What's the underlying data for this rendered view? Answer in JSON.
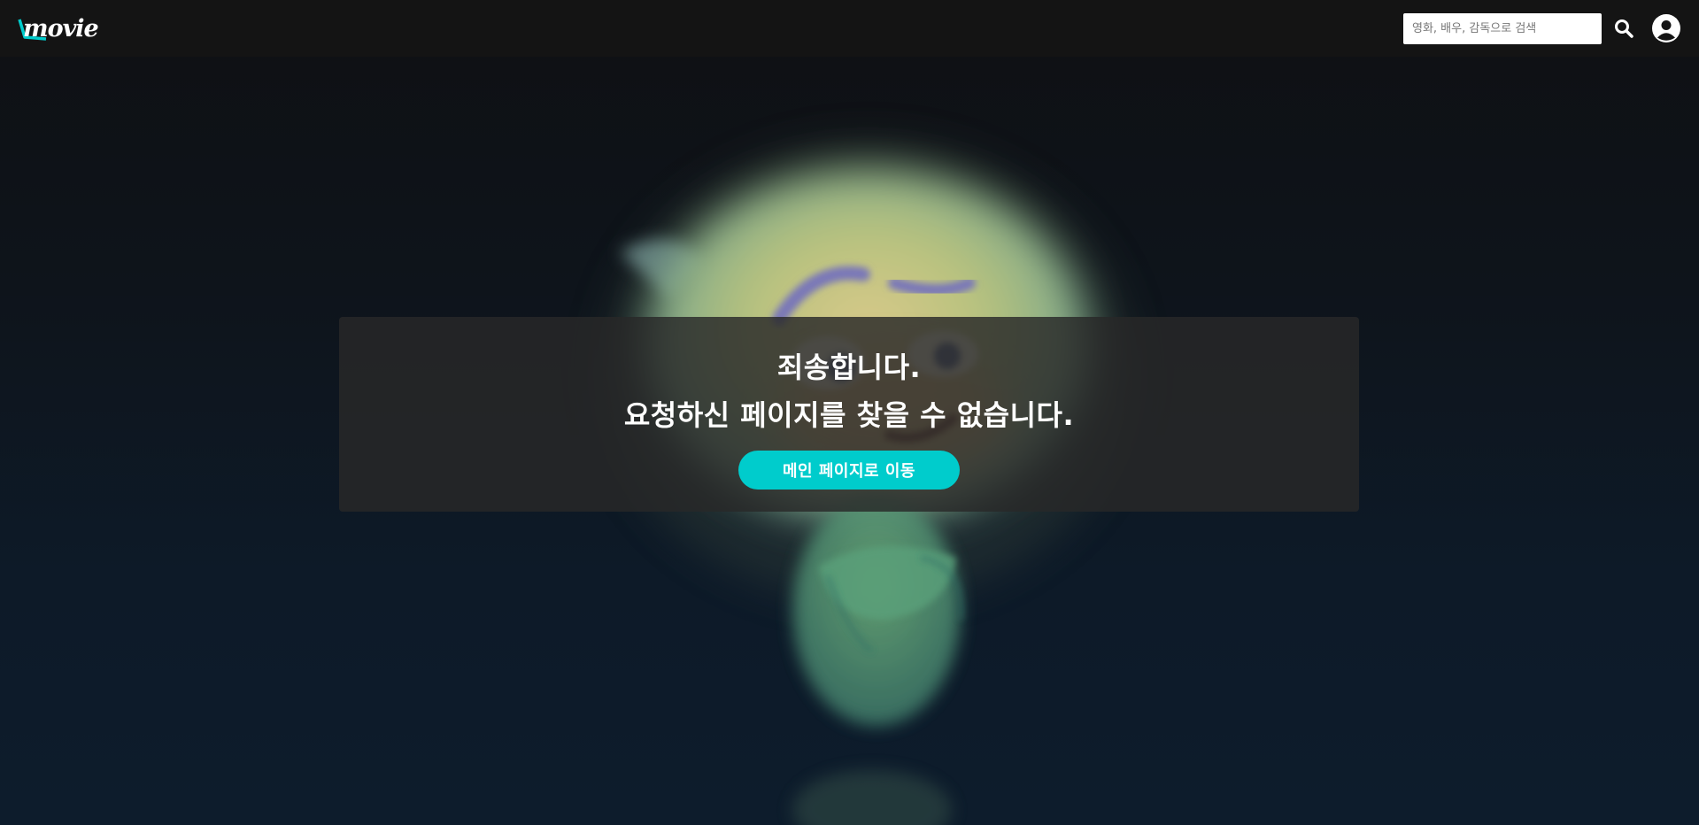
{
  "header": {
    "logo_text": "movie",
    "search": {
      "placeholder": "영화, 배우, 감독으로 검색",
      "value": ""
    },
    "icons": {
      "search": "search-icon",
      "profile": "user-circle-icon"
    }
  },
  "error": {
    "line1": "죄송합니다.",
    "line2": "요청하신 페이지를 찾을 수 없습니다.",
    "home_button_label": "메인 페이지로 이동"
  },
  "colors": {
    "accent": "#00cccc",
    "header_bg": "#141414",
    "panel_bg": "#282828"
  }
}
